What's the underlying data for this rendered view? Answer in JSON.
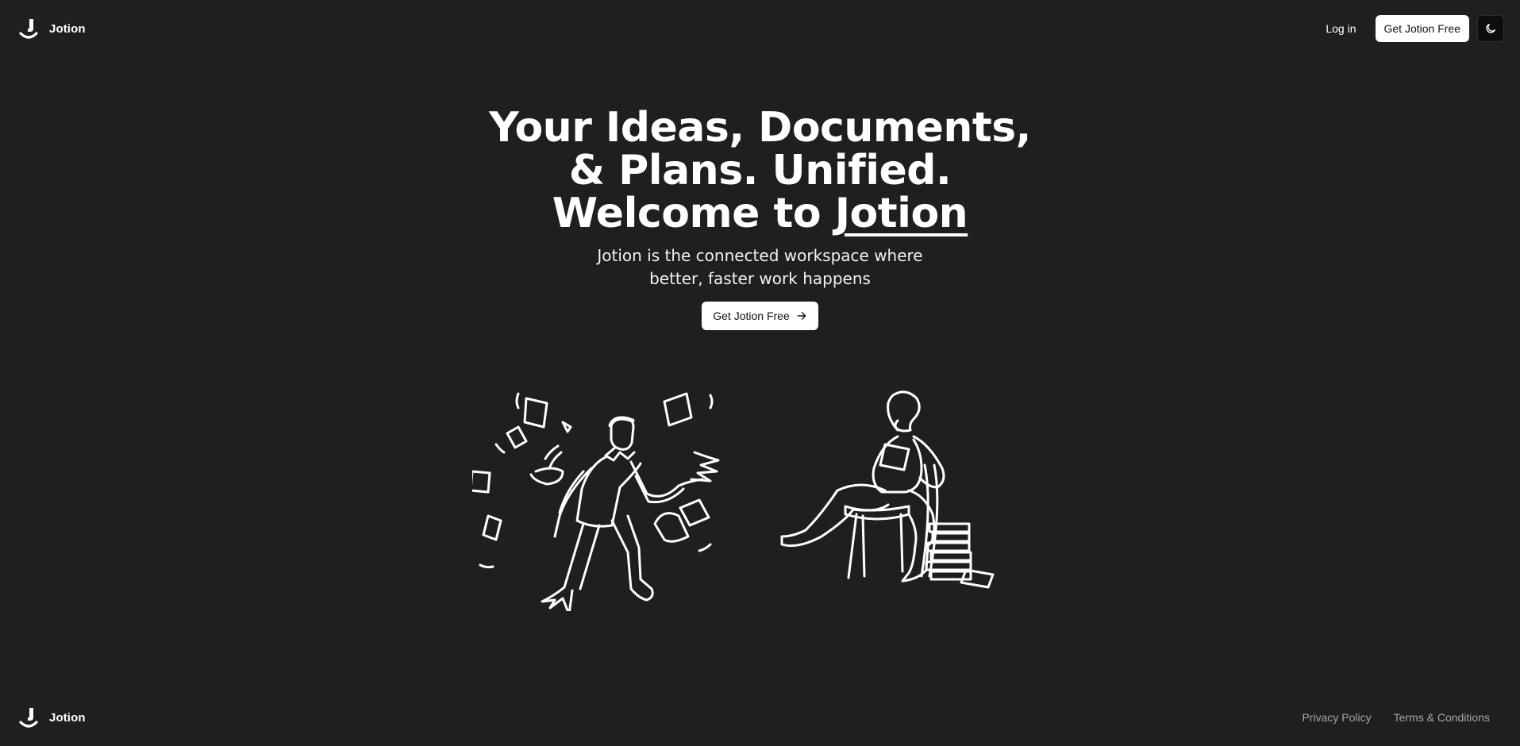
{
  "header": {
    "brand_name": "Jotion",
    "login_label": "Log in",
    "cta_label": "Get Jotion Free",
    "theme_icon": "moon-icon"
  },
  "hero": {
    "title_prefix": "Your Ideas, Documents, & Plans. Unified. Welcome to ",
    "title_highlight": "Jotion",
    "subtitle": "Jotion is the connected workspace where better, faster work happens",
    "cta_label": "Get Jotion Free",
    "cta_icon": "arrow-right-icon"
  },
  "illustrations": {
    "left": "man-with-flying-papers-illustration",
    "right": "woman-reading-in-chair-illustration"
  },
  "footer": {
    "brand_name": "Jotion",
    "privacy_label": "Privacy Policy",
    "terms_label": "Terms & Conditions"
  },
  "colors": {
    "background": "#1f1f1f",
    "text": "#ffffff",
    "button_bg": "#ffffff",
    "button_text": "#111111",
    "muted_link": "#a6a6a6"
  }
}
